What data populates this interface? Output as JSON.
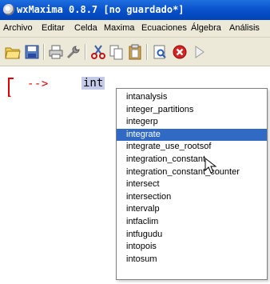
{
  "window": {
    "title": "wxMaxima 0.8.7 [no guardado*]"
  },
  "menu": [
    "Archivo",
    "Editar",
    "Celda",
    "Maxima",
    "Ecuaciones",
    "Álgebra",
    "Análisis"
  ],
  "toolbar": [
    "open-icon",
    "save-icon",
    "print-icon",
    "preferences-icon",
    "cut-icon",
    "copy-icon",
    "paste-icon",
    "select-all-icon",
    "interrupt-icon",
    "next-icon"
  ],
  "cell": {
    "prompt": "-->",
    "input": "int"
  },
  "autocomplete": {
    "items": [
      "intanalysis",
      "integer_partitions",
      "integerp",
      "integrate",
      "integrate_use_rootsof",
      "integration_constant",
      "integration_constant_counter",
      "intersect",
      "intersection",
      "intervalp",
      "intfaclim",
      "intfugudu",
      "intopois",
      "intosum"
    ],
    "selected_index": 3
  }
}
